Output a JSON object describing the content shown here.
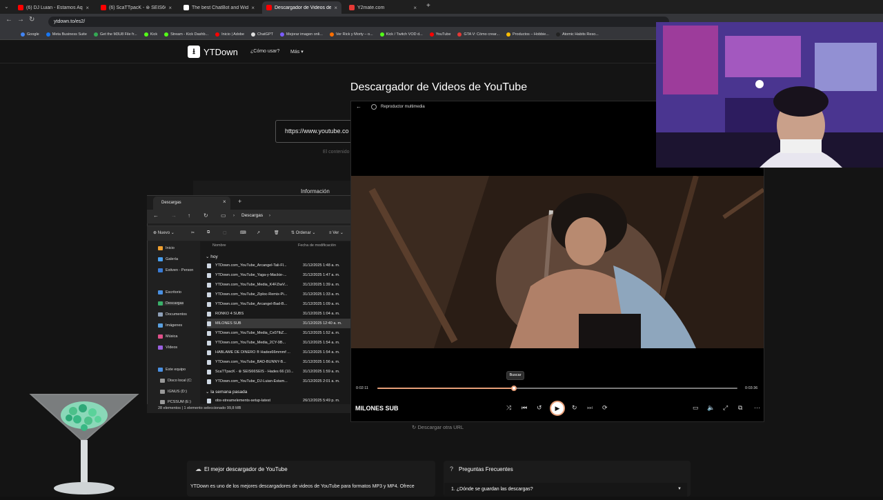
{
  "browser": {
    "tabs": [
      {
        "label": "(6) DJ Luian - Estamos Aqui ft...",
        "color": "#ff0000"
      },
      {
        "label": "(6) ScaTTpacK - ⊛ SEIS66SEIS -",
        "color": "#ff0000"
      },
      {
        "label": "The best ChatBot and Widgets",
        "color": "#ffffff"
      },
      {
        "label": "Descargador de Videos de YouTube",
        "color": "#ff0000"
      },
      {
        "label": "Y2mate.com",
        "color": "#e53935"
      }
    ],
    "new_tab": "+",
    "url": "ytdown.to/es2/",
    "bookmarks": [
      {
        "label": "Google",
        "color": "#4285f4"
      },
      {
        "label": "Meta Business Suite",
        "color": "#1877f2"
      },
      {
        "label": "Get the M3U8 File fr...",
        "color": "#34a853"
      },
      {
        "label": "Kick",
        "color": "#53fc18"
      },
      {
        "label": "Stream - Kick Dashb...",
        "color": "#53fc18"
      },
      {
        "label": "Inicio | Adobe",
        "color": "#ff0000"
      },
      {
        "label": "ChatGPT",
        "color": "#dddddd"
      },
      {
        "label": "Mejorar imagen onli...",
        "color": "#7b5cff"
      },
      {
        "label": "Ver Rick y Morty – o...",
        "color": "#ff6f00"
      },
      {
        "label": "Kick / Twitch VOD d...",
        "color": "#53fc18"
      },
      {
        "label": "YouTube",
        "color": "#ff0000"
      },
      {
        "label": "GTA V: Cómo crear...",
        "color": "#e53935"
      },
      {
        "label": "Productos – Hobbie...",
        "color": "#fbbc04"
      },
      {
        "label": "Atomic Habits Reso...",
        "color": "#222222"
      }
    ]
  },
  "site": {
    "logo": "YTDown",
    "nav_como": "¿Cómo usar?",
    "nav_mas": "Más",
    "title": "Descargador de Videos de YouTube",
    "input_value": "https://www.youtube.co",
    "content_note": "El contenido",
    "info_label": "Información",
    "download_other": "Descargar otra URL",
    "card1_title": "El mejor descargador de YouTube",
    "card1_body": "YTDown es uno de los mejores descargadores de videos de YouTube para formatos MP3 y MP4. Ofrece",
    "card2_title": "Preguntas Frecuentes",
    "faq1": "1. ¿Dónde se guardan las descargas?"
  },
  "explorer": {
    "tab_title": "Descargas",
    "breadcrumb": "Descargas",
    "toolbar": {
      "new": "Nuevo",
      "sort": "Ordenar",
      "view": "Ver"
    },
    "sidebar": [
      {
        "label": "Inicio",
        "color": "#f0a030"
      },
      {
        "label": "Galería",
        "color": "#4aa0f0"
      },
      {
        "label": "Estiven - Person",
        "color": "#3a7bd5"
      },
      {
        "label": "Escritorio",
        "color": "#4a90e2"
      },
      {
        "label": "Descargas",
        "color": "#3ab06a",
        "selected": true
      },
      {
        "label": "Documentos",
        "color": "#8fa0b8"
      },
      {
        "label": "Imágenes",
        "color": "#5aa0e0"
      },
      {
        "label": "Música",
        "color": "#e0508a"
      },
      {
        "label": "Vídeos",
        "color": "#9a60e0"
      },
      {
        "label": "Este equipo",
        "color": "#4a90e2"
      },
      {
        "label": "Disco local (C:",
        "color": "#999999"
      },
      {
        "label": "IGNUS (D:)",
        "color": "#999999"
      },
      {
        "label": "PCSSUM (E:)",
        "color": "#999999"
      }
    ],
    "columns": {
      "name": "Nombre",
      "date": "Fecha de modificación"
    },
    "group_today": "hoy",
    "group_last_week": "la semana pasada",
    "files": [
      {
        "name": "YTDown.com_YouTube_Arcangel-Tali-Fl...",
        "date": "31/12/2025 1:48 a. m."
      },
      {
        "name": "YTDown.com_YouTube_Yaga-y-Mackie-...",
        "date": "31/12/2025 1:47 a. m."
      },
      {
        "name": "YTDown.com_YouTube_Media_K4FZiwV...",
        "date": "31/12/2025 1:39 a. m."
      },
      {
        "name": "YTDown.com_YouTube_Ziploc-Remix-Pi...",
        "date": "31/12/2025 1:33 a. m."
      },
      {
        "name": "YTDown.com_YouTube_Arcangel-Bad-B...",
        "date": "31/12/2025 1:09 a. m."
      },
      {
        "name": "RONKO 4 SUBS",
        "date": "31/12/2025 1:04 a. m."
      },
      {
        "name": "MILONES SUB",
        "date": "31/12/2025 12:40 a. m.",
        "selected": true
      },
      {
        "name": "YTDown.com_YouTube_Media_Cx07lbZ...",
        "date": "31/12/2025 1:52 a. m."
      },
      {
        "name": "YTDown.com_YouTube_Media_2CY-9B...",
        "date": "31/12/2025 1:54 a. m."
      },
      {
        "name": "HÁBLAME DE DINERO ® Hades66mmmf ...",
        "date": "31/12/2025 1:54 a. m."
      },
      {
        "name": "YTDown.com_YouTube_BAD-BUNNY-B...",
        "date": "31/12/2025 1:56 a. m."
      },
      {
        "name": "ScaTTpacK - ⊛ SEIS66SEIS - Hades 66 (10...",
        "date": "31/12/2025 1:59 a. m."
      },
      {
        "name": "YTDown.com_YouTube_DJ-Luian-Estam...",
        "date": "31/12/2025 2:01 a. m."
      }
    ],
    "last_week_file": {
      "name": "obs-streamelements-setup-latest",
      "date": "26/12/2025 5:49 p. m."
    },
    "status": "28 elementos  |  1 elemento seleccionado  99,8 MB"
  },
  "player": {
    "app_title": "Reproductor multimedia",
    "tooltip": "Buscar",
    "current_time": "0:02:11",
    "total_time": "0:03:36",
    "progress": 0.38,
    "track_name": "MILONES SUB",
    "accent": "#e8a07a"
  }
}
